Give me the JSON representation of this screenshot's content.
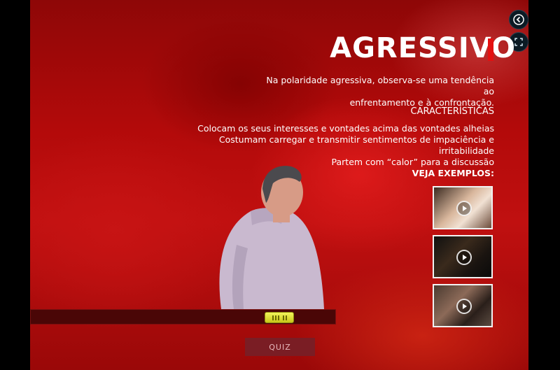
{
  "header": {
    "title": "AGRESSIVO"
  },
  "intro": {
    "line1": "Na polaridade agressiva, observa-se uma tendência ao",
    "line2": "enfrentamento e à confrontação."
  },
  "characteristics": {
    "heading": "CARACTERÍSTICAS",
    "items": [
      "Colocam os seus interesses e vontades acima das vontades alheias",
      "Costumam carregar e transmitir sentimentos de impaciência e irritabilidade",
      "Partem com “calor” para a discussão"
    ]
  },
  "examples": {
    "heading": "VEJA EXEMPLOS:"
  },
  "controls": {
    "back_icon": "chevron-left-icon",
    "fullscreen_icon": "fullscreen-icon"
  },
  "quiz": {
    "label": "QUIZ"
  },
  "colors": {
    "accent": "#e41010",
    "background": "#b30a0a",
    "slider": "#e6e63a"
  }
}
